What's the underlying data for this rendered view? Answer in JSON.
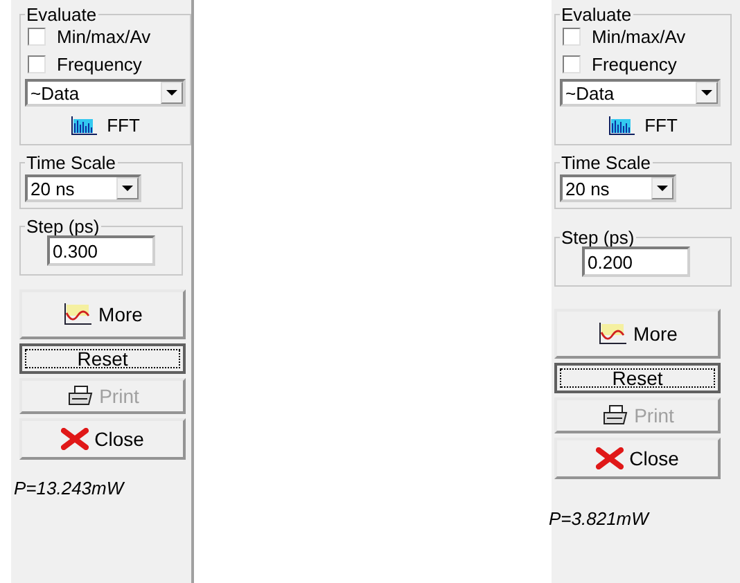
{
  "panels": [
    {
      "evaluate": {
        "title": "Evaluate",
        "checkboxes": [
          {
            "label": "Min/max/Av",
            "checked": false
          },
          {
            "label": "Frequency",
            "checked": false
          }
        ],
        "dropdown": "~Data",
        "fft": "FFT"
      },
      "time_scale": {
        "title": "Time Scale",
        "value": "20 ns"
      },
      "step": {
        "title": "Step (ps)",
        "value": "0.300"
      },
      "buttons": [
        {
          "kind": "more",
          "label": "More",
          "disabled": false,
          "focused": false
        },
        {
          "kind": "reset",
          "label": "Reset",
          "disabled": false,
          "focused": true
        },
        {
          "kind": "print",
          "label": "Print",
          "disabled": true,
          "focused": false
        },
        {
          "kind": "close",
          "label": "Close",
          "disabled": false,
          "focused": false
        }
      ],
      "power": "P=13.243mW"
    },
    {
      "evaluate": {
        "title": "Evaluate",
        "checkboxes": [
          {
            "label": "Min/max/Av",
            "checked": false
          },
          {
            "label": "Frequency",
            "checked": false
          }
        ],
        "dropdown": "~Data",
        "fft": "FFT"
      },
      "time_scale": {
        "title": "Time Scale",
        "value": "20 ns"
      },
      "step": {
        "title": "Step (ps)",
        "value": "0.200"
      },
      "buttons": [
        {
          "kind": "more",
          "label": "More",
          "disabled": false,
          "focused": false
        },
        {
          "kind": "reset",
          "label": "Reset",
          "disabled": false,
          "focused": true
        },
        {
          "kind": "print",
          "label": "Print",
          "disabled": true,
          "focused": false
        },
        {
          "kind": "close",
          "label": "Close",
          "disabled": false,
          "focused": false
        }
      ],
      "power": "P=3.821mW"
    }
  ]
}
